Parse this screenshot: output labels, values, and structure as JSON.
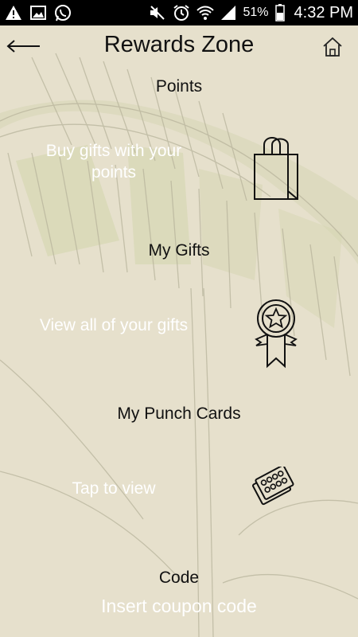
{
  "status_bar": {
    "battery_percent": "51%",
    "time": "4:32 PM",
    "icons": [
      "warning-icon",
      "image-icon",
      "whatsapp-icon",
      "mute-icon",
      "alarm-icon",
      "wifi-icon",
      "signal-icon",
      "battery-icon"
    ]
  },
  "header": {
    "title": "Rewards Zone",
    "back_icon": "arrow-left-icon",
    "home_icon": "home-icon"
  },
  "sections": {
    "points": {
      "title": "Points",
      "text": "Buy gifts with your points",
      "icon": "shopping-bag-icon"
    },
    "gifts": {
      "title": "My Gifts",
      "text": "View all of your gifts",
      "icon": "award-ribbon-icon"
    },
    "punch_cards": {
      "title": "My Punch Cards",
      "text": "Tap to view",
      "icon": "punch-card-icon"
    },
    "code": {
      "title": "Code",
      "placeholder": "Insert coupon code"
    }
  }
}
